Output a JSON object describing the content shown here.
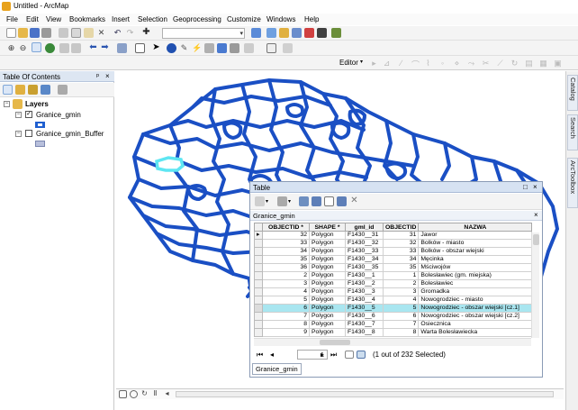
{
  "window": {
    "title": "Untitled - ArcMap"
  },
  "menu": [
    "File",
    "Edit",
    "View",
    "Bookmarks",
    "Insert",
    "Selection",
    "Geoprocessing",
    "Customize",
    "Windows",
    "Help"
  ],
  "editor": {
    "label": "Editor"
  },
  "toc": {
    "title": "Table Of Contents",
    "pin": "ᵖ",
    "close": "×",
    "root": "Layers",
    "layers": [
      {
        "name": "Granice_gmin",
        "checked": "✓",
        "symbol_color": "#1f5fd0"
      },
      {
        "name": "Granice_gmin_Buffer",
        "checked": "",
        "symbol_color": "#b8c0dc"
      }
    ]
  },
  "dock_tabs": [
    "Catalog",
    "Search",
    "ArcToolbox"
  ],
  "table": {
    "window_title": "Table",
    "tab_name": "Granice_gmin",
    "columns": [
      "OBJECTID *",
      "SHAPE *",
      "gml_id",
      "OBJECTID",
      "NAZWA"
    ],
    "rows": [
      [
        "32",
        "Polygon",
        "F1430__31",
        "31",
        "Jawor"
      ],
      [
        "33",
        "Polygon",
        "F1430__32",
        "32",
        "Bolków - miasto"
      ],
      [
        "34",
        "Polygon",
        "F1430__33",
        "33",
        "Bolków - obszar wiejski"
      ],
      [
        "35",
        "Polygon",
        "F1430__34",
        "34",
        "Męcinka"
      ],
      [
        "36",
        "Polygon",
        "F1430__35",
        "35",
        "Mściwojów"
      ],
      [
        "2",
        "Polygon",
        "F1430__1",
        "1",
        "Bolesławiec (gm. miejska)"
      ],
      [
        "3",
        "Polygon",
        "F1430__2",
        "2",
        "Bolesławiec"
      ],
      [
        "4",
        "Polygon",
        "F1430__3",
        "3",
        "Gromadka"
      ],
      [
        "5",
        "Polygon",
        "F1430__4",
        "4",
        "Nowogrodziec - miasto"
      ],
      [
        "6",
        "Polygon",
        "F1430__5",
        "5",
        "Nowogrodziec - obszar wiejski [cz.1]"
      ],
      [
        "7",
        "Polygon",
        "F1430__6",
        "6",
        "Nowogrodziec - obszar wiejski [cz.2]"
      ],
      [
        "8",
        "Polygon",
        "F1430__7",
        "7",
        "Osiecznica"
      ],
      [
        "9",
        "Polygon",
        "F1430__8",
        "8",
        "Warta Bolesławiecka"
      ]
    ],
    "selected_row": 9,
    "nav": {
      "record": "1",
      "status": "(1 out of 232 Selected)"
    },
    "bottom_tab": "Granice_gmin"
  },
  "colors": {
    "boundary": "#1a4fc4",
    "highlight": "#5ee6f2",
    "selection_row": "#a9e6f0"
  }
}
